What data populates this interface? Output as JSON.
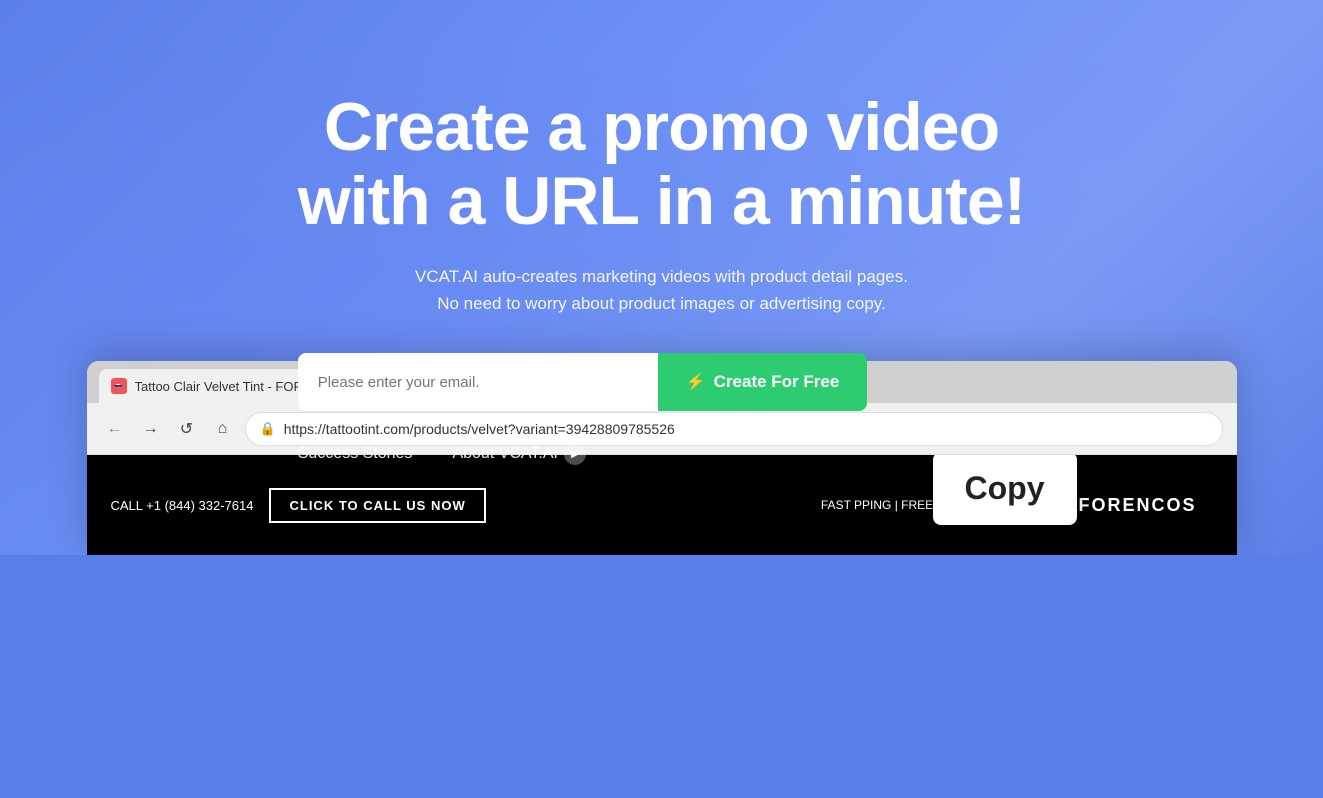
{
  "hero": {
    "title_line1": "Create a promo video",
    "title_line2": "with a URL in a minute!",
    "subtitle_line1": "VCAT.AI auto-creates marketing videos with product detail pages.",
    "subtitle_line2": "No need to worry about product images or advertising copy.",
    "email_placeholder": "Please enter your email.",
    "create_btn_label": "Create For Free",
    "link_success": "Success Stories",
    "link_about": "About VCAT.AI"
  },
  "browser": {
    "tab_title": "Tattoo Clair Velvet Tint - FOREN",
    "tab_favicon": "👄",
    "new_tab_icon": "+",
    "nav_back": "←",
    "nav_forward": "→",
    "nav_refresh": "↺",
    "nav_home": "⌂",
    "address_url": "https://tattootint.com/products/velvet?variant=39428809785526",
    "lock_icon": "🔒"
  },
  "website": {
    "fast_shipping_text": "FAST",
    "shipping_banner": "PPING | FREE SHI",
    "call_number": "CALL +1 (844) 332-7614",
    "click_to_call_label": "CLICK TO CALL US NOW",
    "brand_name": "FORENCOS"
  },
  "copy_tooltip": {
    "label": "Copy"
  },
  "colors": {
    "hero_bg": "#6080ec",
    "green": "#2ecc71",
    "black": "#000000",
    "white": "#ffffff"
  }
}
